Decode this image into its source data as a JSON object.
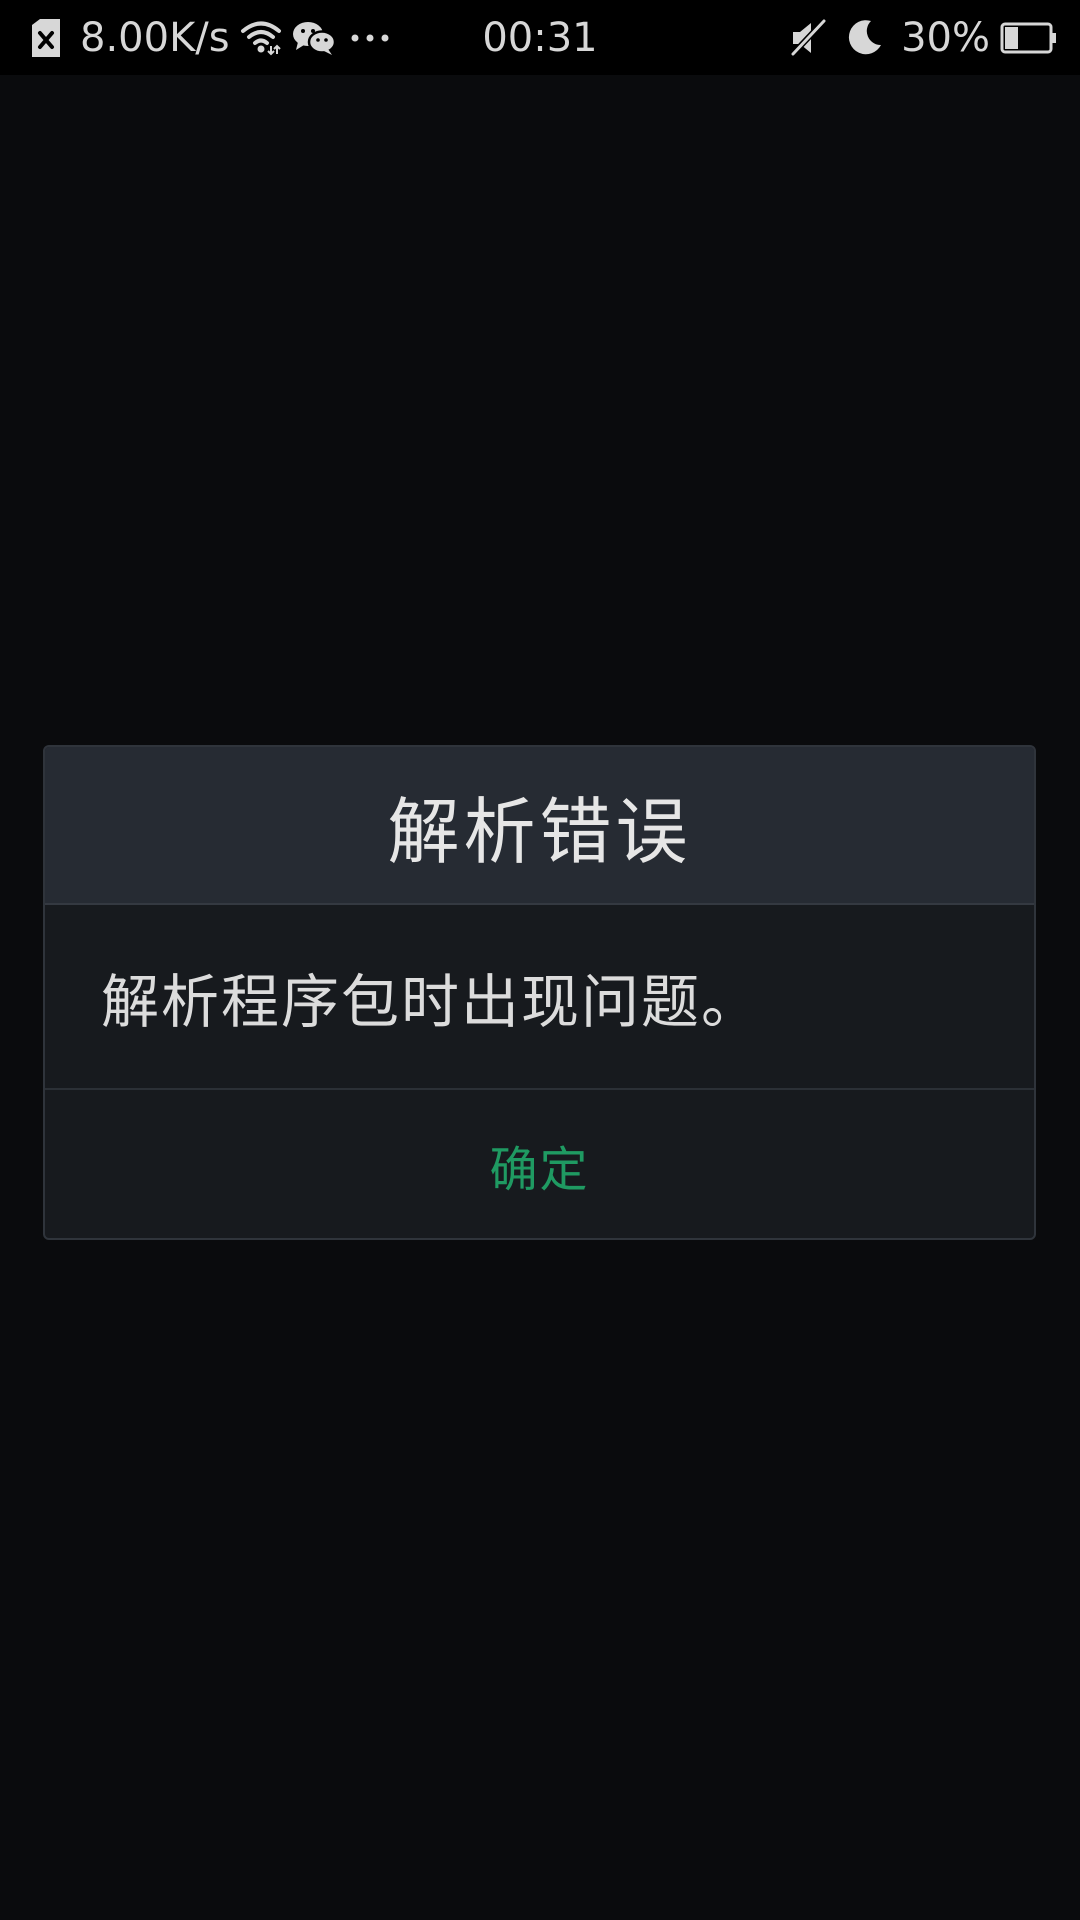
{
  "status_bar": {
    "network_speed": "8.00K/s",
    "time": "00:31",
    "battery_percent": "30%",
    "battery_level": 0.3,
    "icons": [
      "sim-off-icon",
      "wifi-icon",
      "wechat-icon",
      "more-icon",
      "mute-icon",
      "moon-icon",
      "battery-icon"
    ]
  },
  "dialog": {
    "title": "解析错误",
    "message": "解析程序包时出现问题。",
    "ok_label": "确定"
  },
  "colors": {
    "accent": "#1f9a62",
    "background": "#0a0b0d",
    "dialog_header": "#262b33",
    "dialog_body": "#171a1e"
  }
}
